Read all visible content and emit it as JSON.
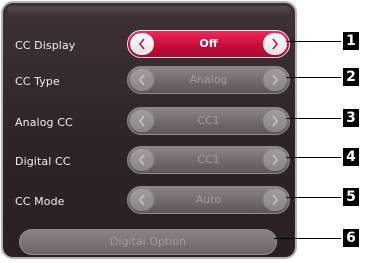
{
  "settings": {
    "rows": [
      {
        "label": "CC Display",
        "value": "Off"
      },
      {
        "label": "CC Type",
        "value": "Analog"
      },
      {
        "label": "Analog CC",
        "value": "CC1"
      },
      {
        "label": "Digital CC",
        "value": "CC1"
      },
      {
        "label": "CC Mode",
        "value": "Auto"
      }
    ],
    "digital_option_label": "Digital Option"
  },
  "callouts": [
    "1",
    "2",
    "3",
    "4",
    "5",
    "6"
  ],
  "colors": {
    "active_accent": "#d0123f",
    "panel_background": "#33282c",
    "inactive_control": "#6f6769"
  }
}
